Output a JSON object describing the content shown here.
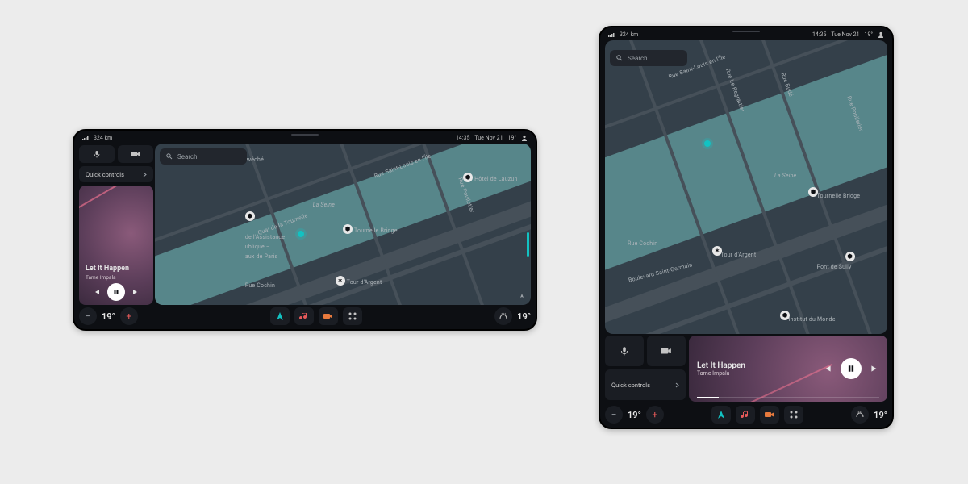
{
  "statusbar": {
    "signal_icon": "signal-icon",
    "range": "324 km",
    "time": "14:35",
    "date": "Tue Nov 21",
    "outside_temp": "19°",
    "profile_icon": "user-icon"
  },
  "search": {
    "placeholder": "Search"
  },
  "quick_controls": {
    "label": "Quick controls"
  },
  "now_playing": {
    "title": "Let It Happen",
    "artist": "Tame Impala"
  },
  "climate": {
    "left_temp": "19°",
    "right_temp": "19°"
  },
  "map": {
    "river_label": "La Seine",
    "current_location_icon": "location-dot",
    "streets": [
      "Rue Saint-Louis en l'Île",
      "Rue Budé",
      "Rue Le Regrattier",
      "Rue Poulletier",
      "Rue Cochin",
      "Boulevard Saint-Germain",
      "Quai de la Tournelle"
    ],
    "pois": [
      {
        "name": "Tournelle Bridge"
      },
      {
        "name": "Tour d'Argent"
      },
      {
        "name": "Hôtel de Lauzun"
      },
      {
        "name": "Pont de Sully"
      },
      {
        "name": "Institut du Monde"
      }
    ],
    "landscape_cutoff": {
      "poi_line1": "de l'Assistance",
      "poi_line2": "ublique –",
      "poi_line3": "aux de Paris",
      "street_suffix": "evêché"
    }
  },
  "dock": {
    "nav_icon": "navigation-icon",
    "music_icon": "music-icon",
    "camera_icon": "camera-icon",
    "apps_icon": "apps-grid-icon",
    "defrost_icon": "defrost-icon",
    "minus": "−",
    "plus": "+"
  },
  "top_icons": {
    "mic": "mic-icon",
    "dashcam": "dashcam-icon"
  }
}
